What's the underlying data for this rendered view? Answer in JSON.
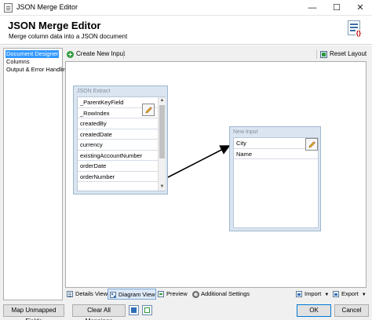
{
  "window": {
    "title": "JSON Merge Editor",
    "minimize": "—",
    "maximize": "☐",
    "close": "✕"
  },
  "header": {
    "title": "JSON Merge Editor",
    "subtitle": "Merge column data into a JSON document"
  },
  "sidebar": {
    "items": [
      {
        "label": "Document Designer",
        "selected": true
      },
      {
        "label": "Columns",
        "selected": false
      },
      {
        "label": "Output & Error Handling",
        "selected": false
      }
    ]
  },
  "toolbar": {
    "create_input": "Create New Input",
    "reset_layout": "Reset Layout"
  },
  "nodes": {
    "json_extract": {
      "title": "JSON Extract",
      "fields": [
        "_ParentKeyField",
        "_RowIndex",
        "createdBy",
        "createdDate",
        "currency",
        "existingAccountNumber",
        "orderDate",
        "orderNumber"
      ],
      "scroll_up": "▲",
      "scroll_down": "▼"
    },
    "new_input": {
      "title": "New Input",
      "fields": [
        "City",
        "Name"
      ]
    }
  },
  "bottom_tabs": {
    "details": "Details View",
    "diagram": "Diagram View",
    "preview": "Preview",
    "settings": "Additional Settings",
    "import": "Import",
    "export": "Export",
    "caret": "▼"
  },
  "footer": {
    "map_unmapped": "Map Unmapped Fields",
    "clear_mappings": "Clear All Mappings",
    "ok": "OK",
    "cancel": "Cancel"
  },
  "colors": {
    "accent": "#3399ff",
    "node_bg": "#dbe5f1",
    "connector": "#000000"
  }
}
